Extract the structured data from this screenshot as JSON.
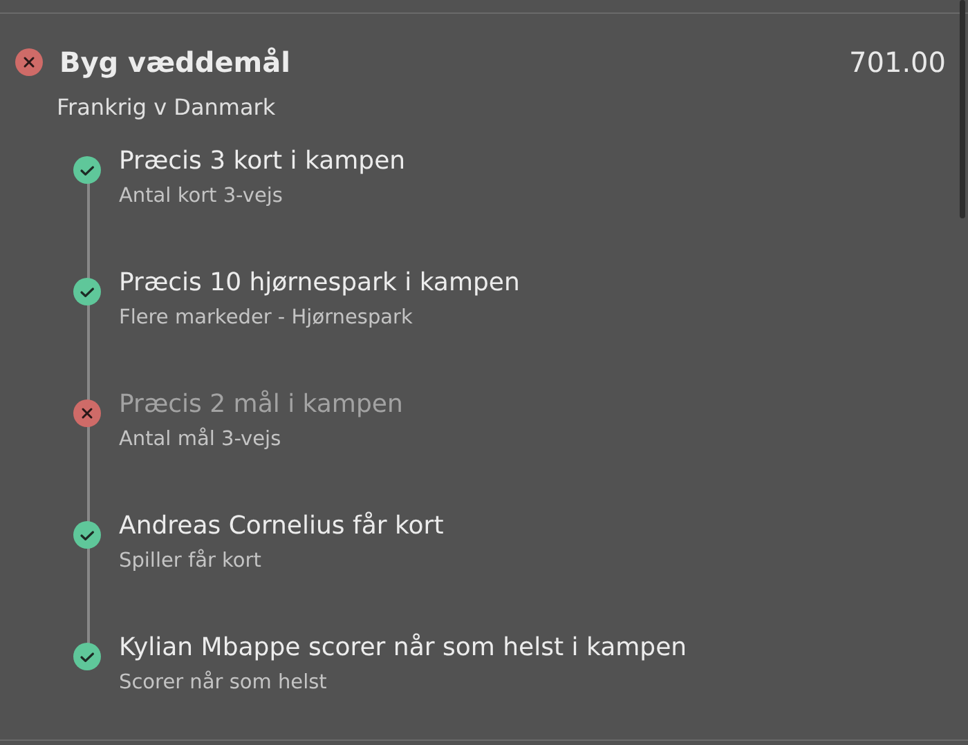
{
  "bet": {
    "title": "Byg væddemål",
    "won": false,
    "odds": "701.00",
    "match": "Frankrig v Danmark",
    "legs": [
      {
        "selection": "Præcis 3 kort i kampen",
        "market": "Antal kort 3-vejs",
        "won": true
      },
      {
        "selection": "Præcis 10 hjørnespark i kampen",
        "market": "Flere markeder - Hjørnespark",
        "won": true
      },
      {
        "selection": "Præcis 2 mål i kampen",
        "market": "Antal mål 3-vejs",
        "won": false
      },
      {
        "selection": "Andreas Cornelius får kort",
        "market": "Spiller får kort",
        "won": true
      },
      {
        "selection": "Kylian Mbappe scorer når som helst i kampen",
        "market": "Scorer når som helst",
        "won": true
      }
    ]
  }
}
